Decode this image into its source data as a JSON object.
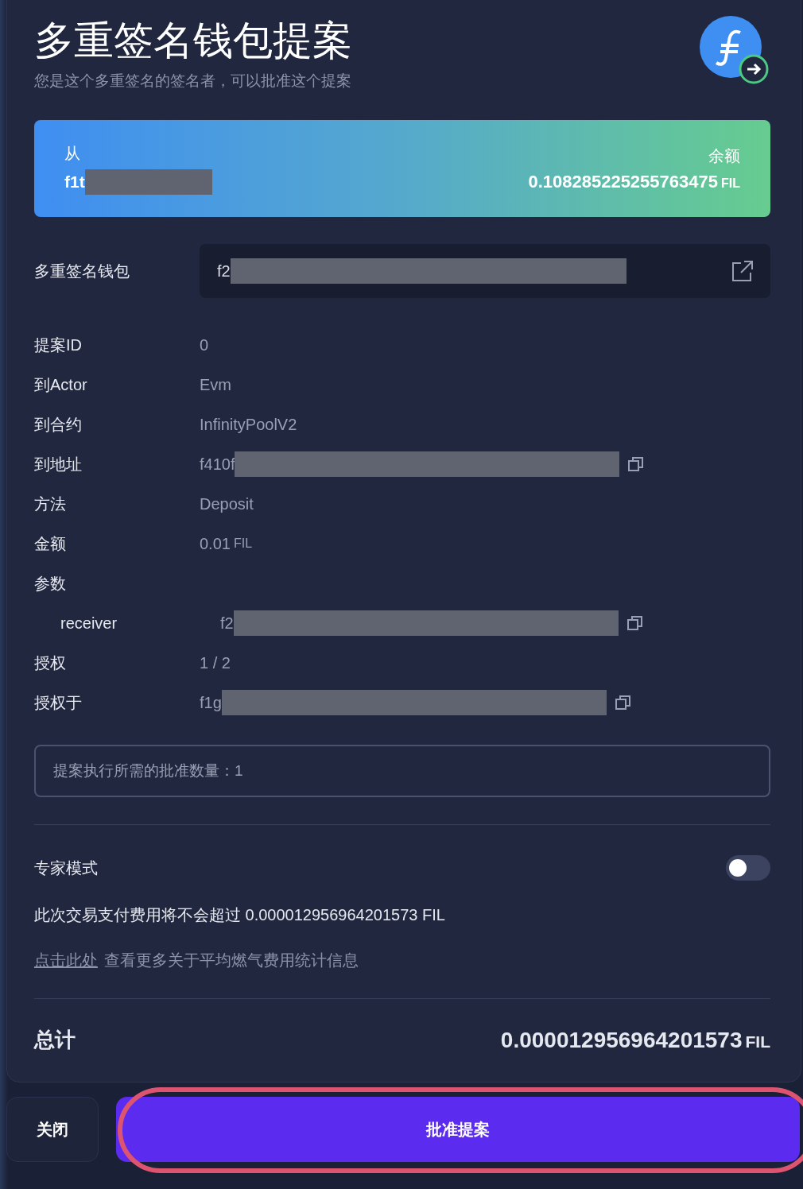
{
  "title": "多重签名钱包提案",
  "subtitle": "您是这个多重签名的签名者，可以批准这个提案",
  "from": {
    "label": "从",
    "address": "f1t"
  },
  "balance": {
    "label": "余额",
    "amount": "0.108285225255763475",
    "unit": "FIL"
  },
  "wallet": {
    "label": "多重签名钱包",
    "address": "f2"
  },
  "details": [
    {
      "kind": "text",
      "label": "提案ID",
      "value": "0"
    },
    {
      "kind": "text",
      "label": "到Actor",
      "value": "Evm"
    },
    {
      "kind": "text",
      "label": "到合约",
      "value": "InfinityPoolV2"
    },
    {
      "kind": "address",
      "label": "到地址",
      "value": "f410f"
    },
    {
      "kind": "text",
      "label": "方法",
      "value": "Deposit"
    },
    {
      "kind": "amount",
      "label": "金额",
      "value": "0.01",
      "unit": "FIL"
    },
    {
      "kind": "group",
      "label": "参数",
      "children": [
        {
          "kind": "address",
          "label": "receiver",
          "value": "f2"
        }
      ]
    },
    {
      "kind": "text",
      "label": "授权",
      "value": "1 / 2"
    },
    {
      "kind": "address",
      "label": "授权于",
      "value": "f1g"
    }
  ],
  "required_note": "提案执行所需的批准数量：1",
  "expert_mode": {
    "label": "专家模式",
    "on": false
  },
  "fee_note": "此次交易支付费用将不会超过 0.000012956964201573 FIL",
  "gas_link": {
    "link": "点击此处",
    "text": "查看更多关于平均燃气费用统计信息"
  },
  "total": {
    "label": "总计",
    "amount": "0.000012956964201573",
    "unit": "FIL"
  },
  "buttons": {
    "close": "关闭",
    "approve": "批准提案",
    "approve_highlighted": true
  }
}
